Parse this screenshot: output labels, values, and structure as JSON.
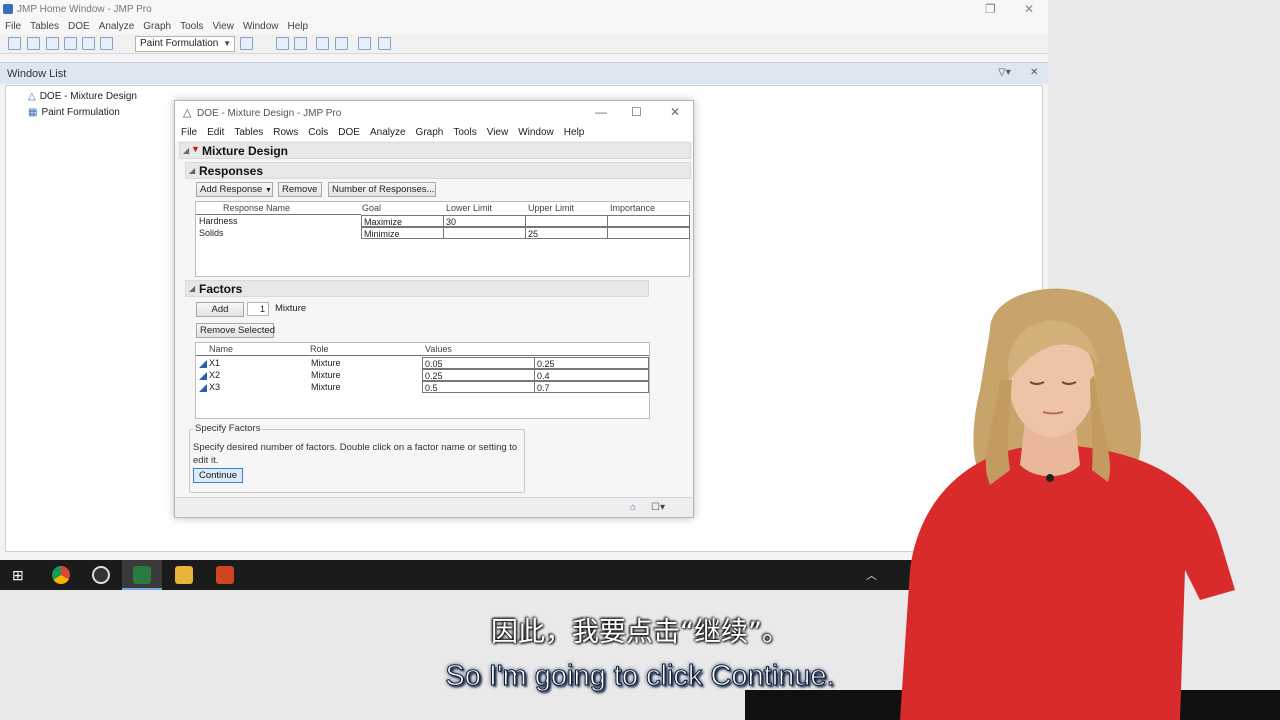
{
  "home": {
    "title": "JMP Home Window - JMP Pro",
    "menu": [
      "File",
      "Tables",
      "DOE",
      "Analyze",
      "Graph",
      "Tools",
      "View",
      "Window",
      "Help"
    ],
    "toolbar_select": "Paint Formulation",
    "window_list": {
      "title": "Window List",
      "items": [
        "DOE - Mixture Design",
        "Paint Formulation"
      ]
    }
  },
  "doe": {
    "title": "DOE - Mixture Design - JMP Pro",
    "menu": [
      "File",
      "Edit",
      "Tables",
      "Rows",
      "Cols",
      "DOE",
      "Analyze",
      "Graph",
      "Tools",
      "View",
      "Window",
      "Help"
    ],
    "section_title": "Mixture Design",
    "responses": {
      "title": "Responses",
      "buttons": [
        "Add Response",
        "Remove",
        "Number of Responses..."
      ],
      "columns": [
        "Response Name",
        "Goal",
        "Lower Limit",
        "Upper Limit",
        "Importance"
      ],
      "rows": [
        {
          "name": "Hardness",
          "goal": "Maximize",
          "lower": "30",
          "upper": "",
          "importance": ""
        },
        {
          "name": "Solids",
          "goal": "Minimize",
          "lower": "",
          "upper": "25",
          "importance": ""
        }
      ]
    },
    "factors": {
      "title": "Factors",
      "add_label": "Add",
      "count": "1",
      "type": "Mixture",
      "remove_selected": "Remove Selected",
      "columns": [
        "Name",
        "Role",
        "Values"
      ],
      "rows": [
        {
          "name": "X1",
          "role": "Mixture",
          "low": "0.05",
          "high": "0.25"
        },
        {
          "name": "X2",
          "role": "Mixture",
          "low": "0.25",
          "high": "0.4"
        },
        {
          "name": "X3",
          "role": "Mixture",
          "low": "0.5",
          "high": "0.7"
        }
      ]
    },
    "specify": {
      "legend": "Specify Factors",
      "text": "Specify desired number of factors. Double click on a factor name or setting to edit it.",
      "continue": "Continue"
    }
  },
  "subtitles": {
    "zh": "因此，我要点击“继续”。",
    "en": "So I'm going to click Continue."
  }
}
